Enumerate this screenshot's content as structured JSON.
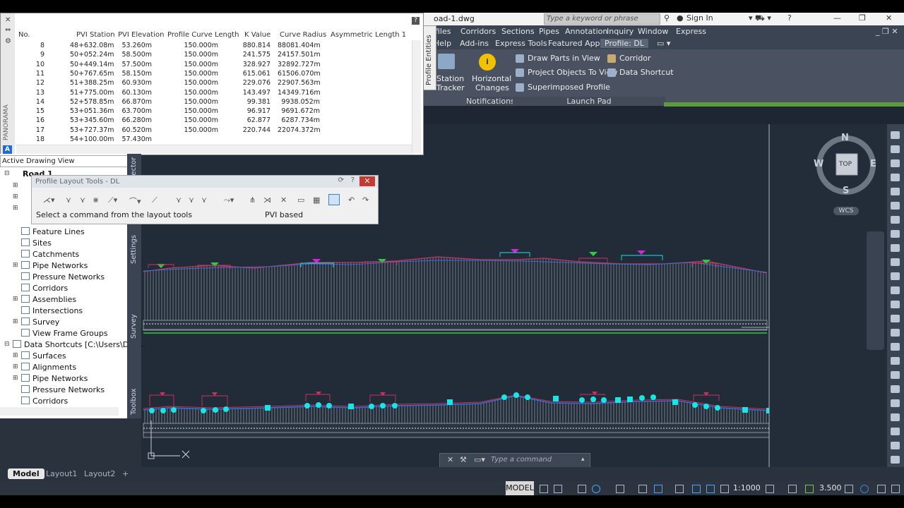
{
  "title_bar": {
    "file_name": "oad-1.dwg",
    "search_placeholder": "Type a keyword or phrase",
    "sign_in": "Sign In",
    "help": "?"
  },
  "menu": [
    "files",
    "Corridors",
    "Sections",
    "Pipes",
    "Annotation",
    "Inquiry",
    "Window",
    "Express"
  ],
  "ribbon_tabs": [
    {
      "label": "Help",
      "active": false
    },
    {
      "label": "Add-ins",
      "active": false
    },
    {
      "label": "Express Tools",
      "active": false
    },
    {
      "label": "Featured Apps",
      "active": false
    },
    {
      "label": "Profile: DL",
      "active": true
    }
  ],
  "ribbon": {
    "station_tracker": [
      "Station",
      "Tracker"
    ],
    "horizontal_changes": [
      "Horizontal",
      "Changes"
    ],
    "notifications_label": "Notifications",
    "launch_pad_label": "Launch Pad",
    "launch_items_left": [
      "Draw Parts in View",
      "Project Objects To View",
      "Superimposed Profile"
    ],
    "launch_items_right": [
      "Corridor",
      "Data Shortcut"
    ]
  },
  "pvi_table": {
    "side_label": "PANORAMA",
    "columns": [
      "No.",
      "PVI Station",
      "PVI Elevation",
      "Profile Curve Length",
      "K Value",
      "Curve Radius",
      "Asymmetric Length 1"
    ],
    "rows": [
      [
        "8",
        "48+632.08m",
        "53.260m",
        "150.000m",
        "880.814",
        "88081.404m"
      ],
      [
        "9",
        "50+052.24m",
        "58.500m",
        "150.000m",
        "241.575",
        "24157.501m"
      ],
      [
        "10",
        "50+449.14m",
        "57.500m",
        "150.000m",
        "328.927",
        "32892.727m"
      ],
      [
        "11",
        "50+767.65m",
        "58.150m",
        "150.000m",
        "615.061",
        "61506.070m"
      ],
      [
        "12",
        "51+388.25m",
        "60.930m",
        "150.000m",
        "229.076",
        "22907.563m"
      ],
      [
        "13",
        "51+775.00m",
        "60.130m",
        "150.000m",
        "143.497",
        "14349.716m"
      ],
      [
        "14",
        "52+578.85m",
        "66.870m",
        "150.000m",
        "99.381",
        "9938.052m"
      ],
      [
        "15",
        "53+051.36m",
        "63.700m",
        "150.000m",
        "96.917",
        "9691.672m"
      ],
      [
        "16",
        "53+345.60m",
        "66.280m",
        "150.000m",
        "62.877",
        "6287.734m"
      ],
      [
        "17",
        "53+727.37m",
        "60.520m",
        "150.000m",
        "220.744",
        "22074.372m"
      ],
      [
        "18",
        "54+100.00m",
        "57.430m",
        "",
        "",
        ""
      ]
    ]
  },
  "profile_entities_tab": "Profile Entities",
  "prospector": {
    "view_selector": "Active Drawing View",
    "root": "Road 1",
    "items": [
      "Feature Lines",
      "Sites",
      "Catchments",
      "Pipe Networks",
      "Pressure Networks",
      "Corridors",
      "Assemblies",
      "Intersections",
      "Survey",
      "View Frame Groups"
    ],
    "data_shortcuts": "Data Shortcuts [C:\\Users\\DEL...",
    "shortcut_items": [
      "Surfaces",
      "Alignments",
      "Pipe Networks",
      "Pressure Networks",
      "Corridors"
    ]
  },
  "toolspace_tabs": [
    "Prospector",
    "Settings",
    "Survey",
    "Toolbox"
  ],
  "layout_tools": {
    "title": "Profile Layout Tools - DL",
    "status_left": "Select a command from the layout tools",
    "status_right": "PVI based"
  },
  "viewcube": {
    "n": "N",
    "s": "S",
    "e": "E",
    "w": "W",
    "top": "TOP",
    "wcs": "WCS"
  },
  "command_line": {
    "placeholder": "Type a command"
  },
  "layout_tabs": [
    {
      "label": "Model",
      "active": true
    },
    {
      "label": "Layout1",
      "active": false
    },
    {
      "label": "Layout2",
      "active": false
    },
    {
      "label": "+",
      "active": false
    }
  ],
  "status_bar": {
    "model": "MODEL",
    "scale": "1:1000",
    "lineweight": "3.500"
  },
  "colors": {
    "accent_ribbon": "#4a5261",
    "grade_line": "#d03060",
    "ground_line": "#3b6cd0",
    "pvi_marker": "#15e6e6",
    "green": "#2ecc40"
  }
}
